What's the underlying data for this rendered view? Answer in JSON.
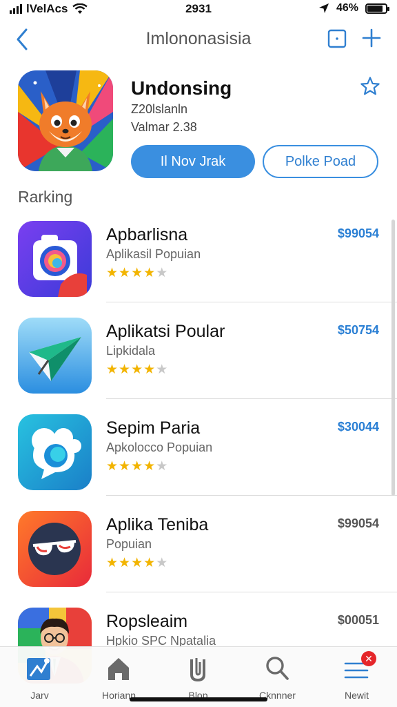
{
  "status_bar": {
    "carrier": "lVelAcs",
    "time": "2931",
    "battery": "46%",
    "battery_level": 0.85,
    "icons": [
      "signal-icon",
      "wifi-icon",
      "location-arrow-icon",
      "battery-icon"
    ]
  },
  "nav": {
    "title": "Imlononasisia",
    "back_icon": "chevron-left-icon",
    "square_icon": "square-icon",
    "plus_icon": "plus-icon"
  },
  "featured": {
    "title": "Undonsing",
    "subtitle_line1": "Z20lslanln",
    "subtitle_line2": "Valmar 2.38",
    "primary_button": "Il Nov Jrak",
    "secondary_button": "Polke Poad",
    "icon": "fox-mascot-icon",
    "star_icon": "star-outline-icon"
  },
  "section": {
    "title": "Rarking"
  },
  "apps": [
    {
      "name": "Apbarlisna",
      "subtitle": "Aplikasil Popuian",
      "price": "$99054",
      "price_color": "#2a7fd4",
      "rating": 4,
      "icon": "camera-app-icon"
    },
    {
      "name": "Aplikatsi Poular",
      "subtitle": "Lipkidala",
      "price": "$50754",
      "price_color": "#2a7fd4",
      "rating": 4,
      "icon": "paper-plane-app-icon"
    },
    {
      "name": "Sepim Paria",
      "subtitle": "Apkolocco Popuian",
      "price": "$30044",
      "price_color": "#2a7fd4",
      "rating": 4,
      "icon": "chat-bubble-app-icon"
    },
    {
      "name": "Aplika Teniba",
      "subtitle": "Popuian",
      "price": "$99054",
      "price_color": "#555555",
      "rating": 4,
      "icon": "sunglasses-app-icon"
    },
    {
      "name": "Ropsleaim",
      "subtitle": "Hpkio SPC Npatalia",
      "price": "$00051",
      "price_color": "#555555",
      "rating": 4,
      "icon": "person-portrait-app-icon"
    }
  ],
  "tabs": [
    {
      "label": "Jarv",
      "icon": "puzzle-tab-icon"
    },
    {
      "label": "Horiann",
      "icon": "home-icon"
    },
    {
      "label": "Blop",
      "icon": "paperclip-icon"
    },
    {
      "label": "Cknnner",
      "icon": "search-icon"
    },
    {
      "label": "Newit",
      "icon": "menu-icon",
      "badge": "✕"
    }
  ],
  "colors": {
    "accent": "#3a8fe0",
    "star": "#f2b400",
    "badge": "#e5262a"
  }
}
